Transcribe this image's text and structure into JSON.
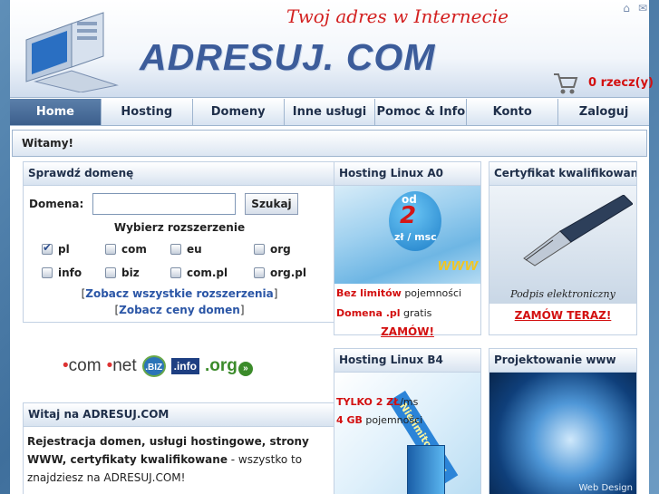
{
  "header": {
    "tagline": "Twoj adres w Internecie",
    "brand": "ADRESUJ. COM",
    "cart_count": "0 rzecz(y)",
    "icons": [
      "home-icon",
      "mail-icon",
      "cart-icon"
    ]
  },
  "nav": {
    "items": [
      {
        "label": "Home"
      },
      {
        "label": "Hosting"
      },
      {
        "label": "Domeny"
      },
      {
        "label": "Inne usługi"
      },
      {
        "label": "Pomoc & Info"
      },
      {
        "label": "Konto"
      },
      {
        "label": "Zaloguj"
      }
    ],
    "active_index": 0
  },
  "welcome_bar": {
    "title": "Witamy!"
  },
  "domain_check": {
    "title": "Sprawdź domenę",
    "field_label": "Domena:",
    "input_value": "",
    "button_label": "Szukaj",
    "ext_title": "Wybierz rozszerzenie",
    "extensions": [
      {
        "label": "pl",
        "checked": true
      },
      {
        "label": "com",
        "checked": false
      },
      {
        "label": "eu",
        "checked": false
      },
      {
        "label": "org",
        "checked": false
      },
      {
        "label": "info",
        "checked": false
      },
      {
        "label": "biz",
        "checked": false
      },
      {
        "label": "com.pl",
        "checked": false
      },
      {
        "label": "org.pl",
        "checked": false
      }
    ],
    "link_all": "Zobacz wszystkie rozszerzenia",
    "link_prices": "Zobacz ceny domen",
    "bracket_open": "[",
    "bracket_close": "]"
  },
  "tld_logos": {
    "com": "com",
    "net": "net",
    "biz": ".BIZ",
    "info": ".info",
    "org": ".org"
  },
  "welcome_panel": {
    "title": "Witaj na ADRESUJ.COM",
    "bold_text": "Rejestracja domen, usługi hostingowe, strony WWW, certyfikaty kwalifikowane",
    "rest_text": " - wszystko to znajdziesz na ADRESUJ.COM!"
  },
  "hosting_a0": {
    "title": "Hosting Linux A0",
    "badge_od": "od",
    "badge_price": "2",
    "badge_currency": "zł",
    "badge_unit": "zł / msc",
    "www": "www",
    "line1_red": "Bez limitów",
    "line1_rest": " pojemności",
    "line2_red": "Domena .pl",
    "line2_rest": " gratis",
    "order": "ZAMÓW!"
  },
  "certificate": {
    "title": "Certyfikat kwalifikowany",
    "caption": "Podpis elektroniczny",
    "order": "ZAMÓW TERAZ!"
  },
  "hosting_b4": {
    "title": "Hosting Linux B4",
    "ribbon": "Nielimitowany",
    "line1_red": "TYLKO 2 ZŁ",
    "line1_rest": "/ms",
    "line2_red": "4 GB",
    "line2_rest": " pojemności"
  },
  "web_design": {
    "title": "Projektowanie www",
    "caption": "Web Design"
  },
  "colors": {
    "accent_red": "#d31010",
    "brand_blue": "#3c5c9a",
    "nav_active": "#3c5f8c",
    "link_blue": "#2b56a6"
  }
}
